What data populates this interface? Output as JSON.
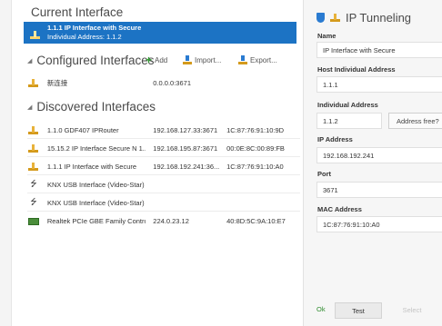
{
  "current": {
    "title": "Current Interface",
    "name": "1.1.1 IP Interface with Secure",
    "address": "Individual Address: 1.1.2"
  },
  "configured": {
    "title": "Configured Interfaces",
    "add": "Add",
    "import": "Import...",
    "export": "Export...",
    "rows": [
      {
        "name": "新连接",
        "ip": "0.0.0.0:3671",
        "mac": "",
        "icon": "plug-icon"
      }
    ]
  },
  "discovered": {
    "title": "Discovered Interfaces",
    "rows": [
      {
        "name": "1.1.0 GDF407 IPRouter",
        "ip": "192.168.127.33:3671",
        "mac": "1C:87:76:91:10:9D",
        "icon": "plug-icon"
      },
      {
        "name": "15.15.2 IP Interface Secure N 1...",
        "ip": "192.168.195.87:3671",
        "mac": "00:0E:8C:00:89:FB",
        "icon": "plug-icon"
      },
      {
        "name": "1.1.1 IP Interface with Secure",
        "ip": "192.168.192.241:36...",
        "mac": "1C:87:76:91:10:A0",
        "icon": "plug-icon"
      },
      {
        "name": "KNX USB Interface (Video-Star)",
        "ip": "",
        "mac": "",
        "icon": "usb-icon"
      },
      {
        "name": "KNX USB Interface (Video-Star)",
        "ip": "",
        "mac": "",
        "icon": "usb-icon"
      },
      {
        "name": "Realtek PCIe GBE Family Contro...",
        "ip": "224.0.23.12",
        "mac": "40:8D:5C:9A:10:E7",
        "icon": "network-card-icon"
      }
    ]
  },
  "details": {
    "title": "IP Tunneling",
    "name_label": "Name",
    "name_value": "IP Interface with Secure",
    "host_label": "Host Individual Address",
    "host_value": "1.1.1",
    "ind_label": "Individual Address",
    "ind_value": "1.1.2",
    "addr_free": "Address free?",
    "ip_label": "IP Address",
    "ip_value": "192.168.192.241",
    "port_label": "Port",
    "port_value": "3671",
    "mac_label": "MAC Address",
    "mac_value": "1C:87:76:91:10:A0"
  },
  "footer": {
    "status": "Ok",
    "test": "Test",
    "select": "Select"
  }
}
